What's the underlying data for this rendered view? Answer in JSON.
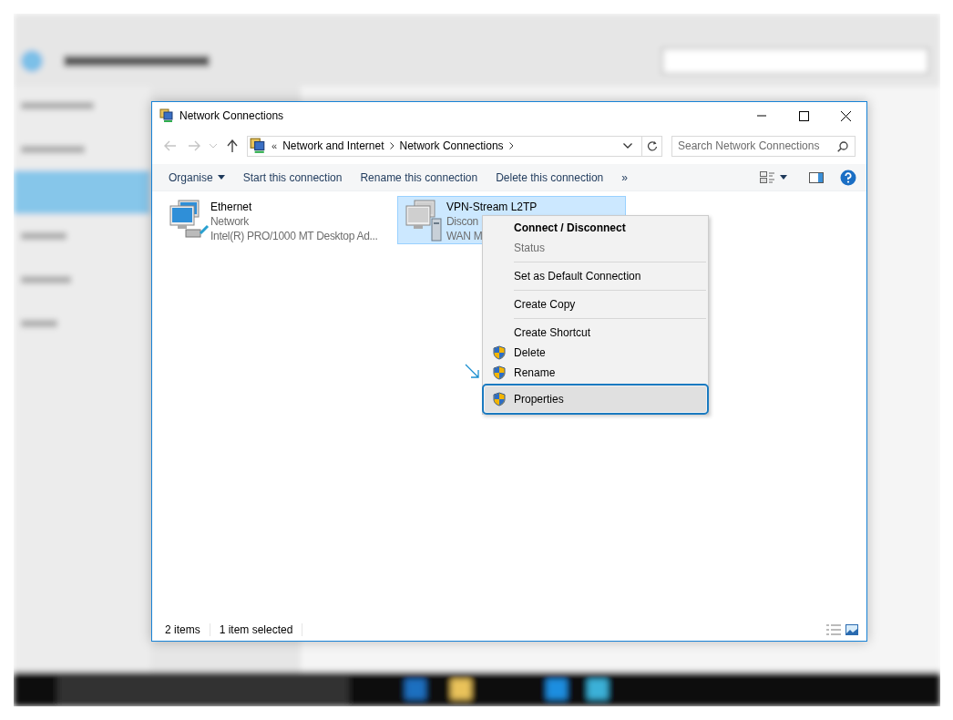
{
  "window": {
    "title": "Network Connections"
  },
  "address": {
    "parts": [
      "Network and Internet",
      "Network Connections"
    ],
    "overflow": "«"
  },
  "search": {
    "placeholder": "Search Network Connections"
  },
  "commands": [
    {
      "label": "Organise",
      "dropdown": true
    },
    {
      "label": "Start this connection",
      "dropdown": false
    },
    {
      "label": "Rename this connection",
      "dropdown": false
    },
    {
      "label": "Delete this connection",
      "dropdown": false
    }
  ],
  "more_commands": "»",
  "connections": [
    {
      "kind": "ethernet",
      "name": "Ethernet",
      "status": "Network",
      "device": "Intel(R) PRO/1000 MT Desktop Ad...",
      "selected": false
    },
    {
      "kind": "vpn",
      "name": "VPN-Stream L2TP",
      "status": "Discon",
      "device": "WAN M",
      "selected": true
    }
  ],
  "context_menu": {
    "groups": [
      [
        {
          "label": "Connect / Disconnect",
          "default": true,
          "disabled": false,
          "shield": false,
          "selected": false
        },
        {
          "label": "Status",
          "default": false,
          "disabled": true,
          "shield": false,
          "selected": false
        }
      ],
      [
        {
          "label": "Set as Default Connection",
          "default": false,
          "disabled": false,
          "shield": false,
          "selected": false
        }
      ],
      [
        {
          "label": "Create Copy",
          "default": false,
          "disabled": false,
          "shield": false,
          "selected": false
        }
      ],
      [
        {
          "label": "Create Shortcut",
          "default": false,
          "disabled": false,
          "shield": false,
          "selected": false
        },
        {
          "label": "Delete",
          "default": false,
          "disabled": false,
          "shield": true,
          "selected": false
        },
        {
          "label": "Rename",
          "default": false,
          "disabled": false,
          "shield": true,
          "selected": false
        },
        {
          "label": "Properties",
          "default": false,
          "disabled": false,
          "shield": true,
          "selected": true
        }
      ]
    ]
  },
  "status_bar": {
    "count": "2 items",
    "selection": "1 item selected"
  }
}
